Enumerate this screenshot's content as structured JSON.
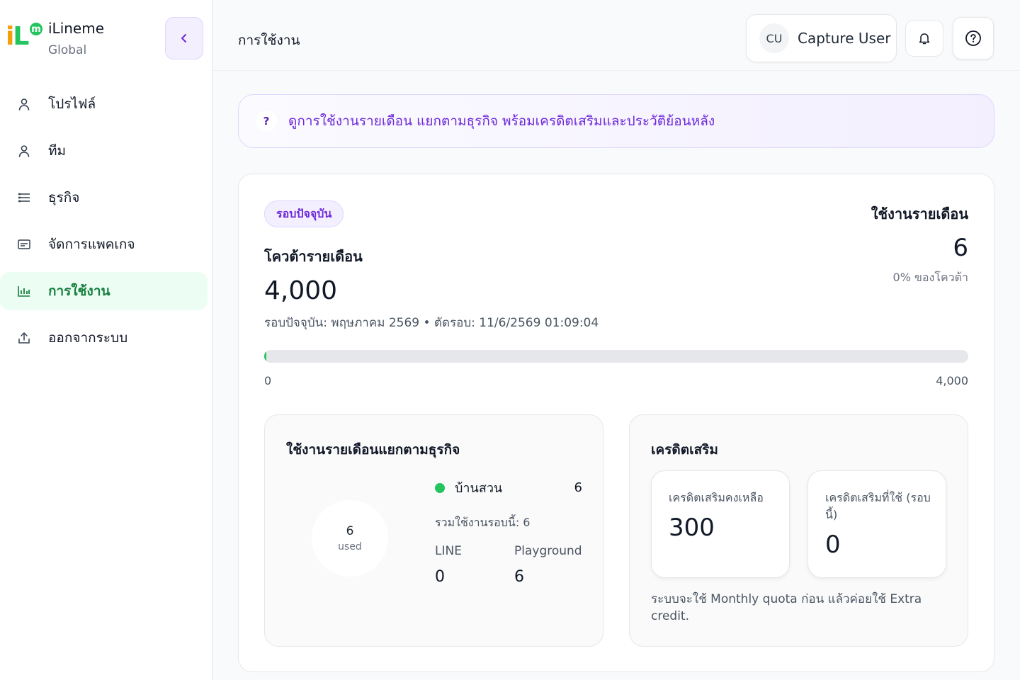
{
  "brand": {
    "name": "iLineme",
    "subtitle": "Global",
    "logo_text": "iL",
    "logo_badge": "m"
  },
  "sidebar": {
    "items": [
      {
        "label": "โปรไฟล์",
        "icon": "user-icon"
      },
      {
        "label": "ทีม",
        "icon": "user-icon"
      },
      {
        "label": "ธุรกิจ",
        "icon": "list-icon"
      },
      {
        "label": "จัดการแพคเกจ",
        "icon": "package-card-icon"
      },
      {
        "label": "การใช้งาน",
        "icon": "bar-chart-icon",
        "active": true
      },
      {
        "label": "ออกจากระบบ",
        "icon": "logout-icon"
      }
    ]
  },
  "header": {
    "title": "การใช้งาน",
    "user": {
      "initials": "CU",
      "name": "Capture User"
    }
  },
  "banner": {
    "icon": "?",
    "text": "ดูการใช้งานรายเดือน แยกตามธุรกิจ พร้อมเครดิตเสริมและประวัติย้อนหลัง"
  },
  "quota": {
    "badge": "รอบปัจจุบัน",
    "title": "โควต้ารายเดือน",
    "value": "4,000",
    "meta": "รอบปัจจุบัน: พฤษภาคม 2569 • ตัดรอบ: 11/6/2569 01:09:04",
    "used_title": "ใช้งานรายเดือน",
    "used_value": "6",
    "used_pct": "0% ของโควต้า",
    "progress_min": "0",
    "progress_max": "4,000",
    "progress_fraction": 0.0015
  },
  "by_business": {
    "title": "ใช้งานรายเดือนแยกตามธุรกิจ",
    "donut_value": "6",
    "donut_label": "used",
    "business_name": "บ้านสวน",
    "business_count": "6",
    "total": "รวมใช้งานรอบนี้: 6",
    "channels": [
      {
        "label": "LINE",
        "value": "0"
      },
      {
        "label": "Playground",
        "value": "6"
      }
    ]
  },
  "extra_credit": {
    "title": "เครดิตเสริม",
    "remaining_label": "เครดิตเสริมคงเหลือ",
    "remaining_value": "300",
    "used_label": "เครดิตเสริมที่ใช้ (รอบนี้)",
    "used_value": "0",
    "note": "ระบบจะใช้ Monthly quota ก่อน แล้วค่อยใช้ Extra credit."
  },
  "colors": {
    "accent_green": "#22c55e",
    "accent_purple": "#6d28d9",
    "active_bg": "#ecfdf3"
  }
}
